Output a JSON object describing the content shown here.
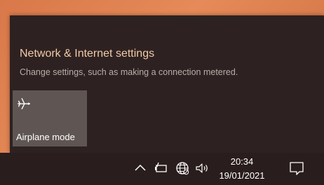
{
  "flyout": {
    "settings_link": "Network & Internet settings",
    "settings_description": "Change settings, such as making a connection metered.",
    "tiles": [
      {
        "label": "Airplane mode",
        "icon": "airplane-icon",
        "active": false
      }
    ]
  },
  "taskbar": {
    "tray_icons": [
      "chevron-up-icon",
      "battery-icon",
      "globe-network-icon",
      "volume-icon"
    ],
    "time": "20:34",
    "date": "19/01/2021",
    "notification_icon": "notification-icon"
  },
  "colors": {
    "accent_link": "#f3c9a7",
    "flyout_bg": "#2d2221",
    "tile_bg": "#5f5654",
    "taskbar_bg": "#2a1d1d"
  }
}
